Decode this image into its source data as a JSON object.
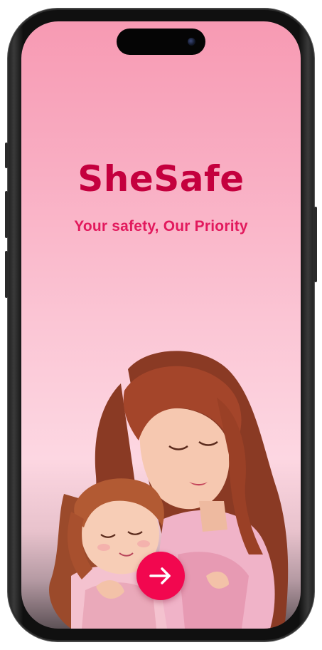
{
  "app": {
    "title": "SheSafe",
    "tagline": "Your safety, Our Priority"
  },
  "illustration": {
    "subject": "mother hugging daughter"
  },
  "next_button": {
    "icon": "arrow-right-icon"
  },
  "colors": {
    "brand": "#c4003e",
    "tagline": "#e2195d",
    "button": "#f2074f",
    "background_top": "#f79ab3",
    "background_bottom": "#fdd7e2"
  }
}
